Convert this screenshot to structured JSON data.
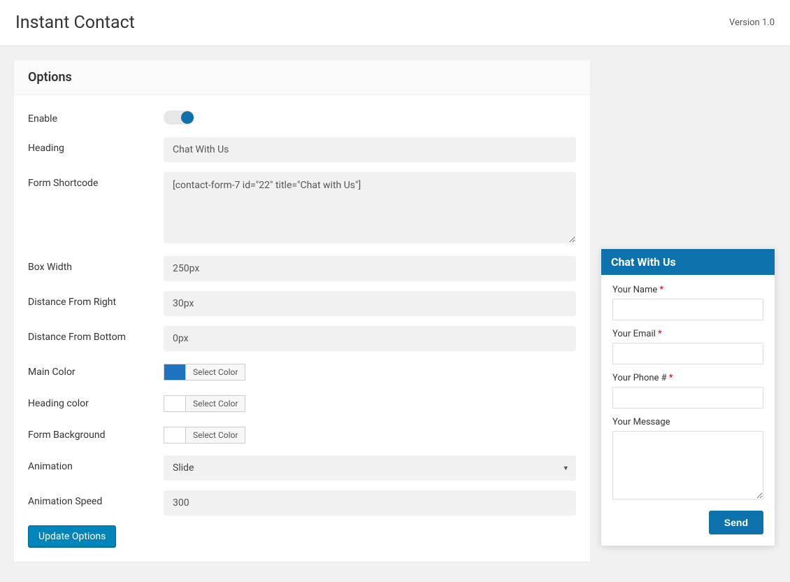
{
  "header": {
    "title": "Instant Contact",
    "version": "Version 1.0"
  },
  "panel": {
    "title": "Options"
  },
  "options": {
    "enable_label": "Enable",
    "enable_value": true,
    "heading_label": "Heading",
    "heading_value": "Chat With Us",
    "shortcode_label": "Form Shortcode",
    "shortcode_value": "[contact-form-7 id=\"22\" title=\"Chat with Us\"]",
    "box_width_label": "Box Width",
    "box_width_value": "250px",
    "distance_right_label": "Distance From Right",
    "distance_right_value": "30px",
    "distance_bottom_label": "Distance From Bottom",
    "distance_bottom_value": "0px",
    "main_color_label": "Main Color",
    "main_color_value": "#1e73be",
    "main_color_btn": "Select Color",
    "heading_color_label": "Heading color",
    "heading_color_value": "#ffffff",
    "heading_color_btn": "Select Color",
    "form_bg_label": "Form Background",
    "form_bg_value": "#ffffff",
    "form_bg_btn": "Select Color",
    "animation_label": "Animation",
    "animation_value": "Slide",
    "animation_speed_label": "Animation Speed",
    "animation_speed_value": "300",
    "submit_label": "Update Options"
  },
  "chat": {
    "title": "Chat With Us",
    "name_label": "Your Name",
    "email_label": "Your Email",
    "phone_label": "Your Phone #",
    "message_label": "Your Message",
    "send_label": "Send"
  }
}
